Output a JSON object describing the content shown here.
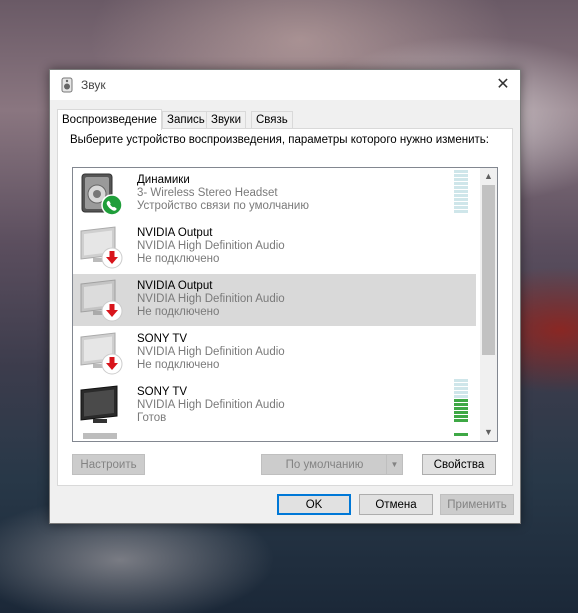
{
  "window": {
    "title": "Звук",
    "close_glyph": "✕"
  },
  "tabs": [
    {
      "label": "Воспроизведение",
      "active": true
    },
    {
      "label": "Запись",
      "active": false
    },
    {
      "label": "Звуки",
      "active": false
    },
    {
      "label": "Связь",
      "active": false
    }
  ],
  "instruction": "Выберите устройство воспроизведения, параметры которого нужно изменить:",
  "devices": [
    {
      "name": "Динамики",
      "model": "3- Wireless Stereo Headset",
      "status": "Устройство связи по умолчанию",
      "icon": "headset-speaker-icon",
      "badge": "phone-badge-icon",
      "selected": false,
      "level": 0
    },
    {
      "name": "NVIDIA Output",
      "model": "NVIDIA High Definition Audio",
      "status": "Не подключено",
      "icon": "monitor-disconnected-icon",
      "badge": "down-arrow-badge-icon",
      "selected": false,
      "level": null
    },
    {
      "name": "NVIDIA Output",
      "model": "NVIDIA High Definition Audio",
      "status": "Не подключено",
      "icon": "monitor-disconnected-icon",
      "badge": "down-arrow-badge-icon",
      "selected": true,
      "level": null
    },
    {
      "name": "SONY TV",
      "model": "NVIDIA High Definition Audio",
      "status": "Не подключено",
      "icon": "monitor-disconnected-icon",
      "badge": "down-arrow-badge-icon",
      "selected": false,
      "level": null
    },
    {
      "name": "SONY TV",
      "model": "NVIDIA High Definition Audio",
      "status": "Готов",
      "icon": "monitor-ready-icon",
      "badge": null,
      "selected": false,
      "level": 0.55
    }
  ],
  "buttons": {
    "configure": "Настроить",
    "set_default": "По умолчанию",
    "properties": "Свойства",
    "ok": "OK",
    "cancel": "Отмена",
    "apply": "Применить"
  },
  "colors": {
    "meter_green": "#3ea845",
    "meter_idle": "#cfe6ea",
    "badge_green": "#1f9e3a",
    "badge_red": "#d8141b",
    "selection": "#d9d9d9"
  }
}
